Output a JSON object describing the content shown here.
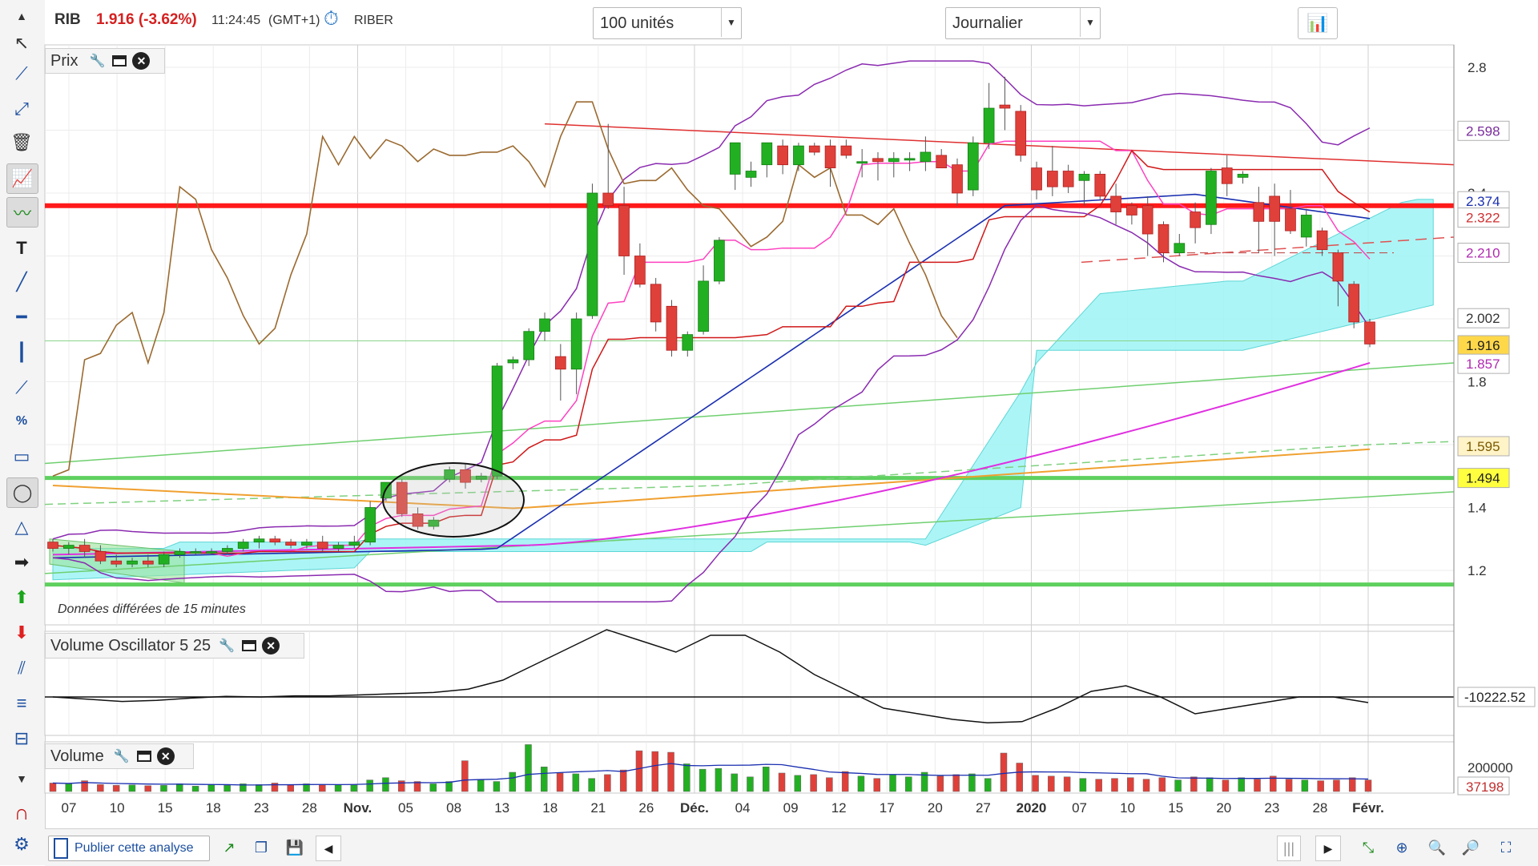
{
  "header": {
    "symbol": "RIB",
    "price_change": "1.916 (-3.62%)",
    "time": "11:24:45",
    "timezone": "(GMT+1)",
    "name": "RIBER",
    "units_select": "100 unités",
    "period_select": "Journalier"
  },
  "panels": {
    "price": "Prix",
    "volume_osc": "Volume Oscillator 5 25",
    "volume": "Volume"
  },
  "delayed_note": "Données différées de 15 minutes",
  "bottom": {
    "publish": "Publier cette analyse"
  },
  "colors": {
    "bull": "#22b022",
    "bear": "#e0403a",
    "ichimoku_cloud": "#9ef3f5",
    "support_line": "#5ed05e",
    "resistance_line": "#ff1a1a"
  },
  "chart_data": {
    "type": "candlestick",
    "x_tick_labels": [
      "07",
      "10",
      "15",
      "18",
      "23",
      "28",
      "Nov.",
      "05",
      "08",
      "13",
      "18",
      "21",
      "26",
      "Déc.",
      "04",
      "09",
      "12",
      "17",
      "20",
      "27",
      "2020",
      "07",
      "10",
      "15",
      "20",
      "23",
      "28",
      "Févr."
    ],
    "price_axis": {
      "ticks": [
        "2.8",
        "2.6",
        "2.4",
        "2.2",
        "2.0",
        "1.8",
        "1.6",
        "1.4",
        "1.2"
      ],
      "range": [
        1.1,
        2.85
      ]
    },
    "price_tags": [
      {
        "value": "2.598",
        "bg": "#ffffff",
        "fg": "#7a2c9c",
        "price": 2.598
      },
      {
        "value": "2.374",
        "bg": "#ffffff",
        "fg": "#1a2fb0",
        "price": 2.374
      },
      {
        "value": "2.322",
        "bg": "#ffffff",
        "fg": "#d03030",
        "price": 2.322
      },
      {
        "value": "2.210",
        "bg": "#ffffff",
        "fg": "#b02ab0",
        "price": 2.21
      },
      {
        "value": "2.002",
        "bg": "#ffffff",
        "fg": "#333333",
        "price": 2.002
      },
      {
        "value": "1.916",
        "bg": "#ffd84a",
        "fg": "#222222",
        "price": 1.916
      },
      {
        "value": "1.857",
        "bg": "#ffffff",
        "fg": "#b02ab0",
        "price": 1.857
      },
      {
        "value": "1.595",
        "bg": "#fff3c8",
        "fg": "#7a5a00",
        "price": 1.595
      },
      {
        "value": "1.494",
        "bg": "#ffff40",
        "fg": "#222222",
        "price": 1.494
      }
    ],
    "volume_osc_tag": "-10222.52",
    "volume_axis": {
      "tick": "200000",
      "last_tag": "37198"
    },
    "candles": [
      {
        "o": 1.29,
        "h": 1.3,
        "l": 1.26,
        "c": 1.27
      },
      {
        "o": 1.27,
        "h": 1.29,
        "l": 1.25,
        "c": 1.28
      },
      {
        "o": 1.28,
        "h": 1.3,
        "l": 1.24,
        "c": 1.26
      },
      {
        "o": 1.26,
        "h": 1.28,
        "l": 1.22,
        "c": 1.23
      },
      {
        "o": 1.23,
        "h": 1.25,
        "l": 1.21,
        "c": 1.22
      },
      {
        "o": 1.22,
        "h": 1.24,
        "l": 1.21,
        "c": 1.23
      },
      {
        "o": 1.23,
        "h": 1.25,
        "l": 1.21,
        "c": 1.22
      },
      {
        "o": 1.22,
        "h": 1.26,
        "l": 1.21,
        "c": 1.25
      },
      {
        "o": 1.25,
        "h": 1.27,
        "l": 1.24,
        "c": 1.26
      },
      {
        "o": 1.26,
        "h": 1.27,
        "l": 1.25,
        "c": 1.26
      },
      {
        "o": 1.26,
        "h": 1.27,
        "l": 1.25,
        "c": 1.26
      },
      {
        "o": 1.26,
        "h": 1.28,
        "l": 1.25,
        "c": 1.27
      },
      {
        "o": 1.27,
        "h": 1.3,
        "l": 1.26,
        "c": 1.29
      },
      {
        "o": 1.29,
        "h": 1.31,
        "l": 1.27,
        "c": 1.3
      },
      {
        "o": 1.3,
        "h": 1.31,
        "l": 1.28,
        "c": 1.29
      },
      {
        "o": 1.29,
        "h": 1.3,
        "l": 1.27,
        "c": 1.28
      },
      {
        "o": 1.28,
        "h": 1.3,
        "l": 1.27,
        "c": 1.29
      },
      {
        "o": 1.29,
        "h": 1.31,
        "l": 1.26,
        "c": 1.27
      },
      {
        "o": 1.27,
        "h": 1.29,
        "l": 1.26,
        "c": 1.28
      },
      {
        "o": 1.28,
        "h": 1.31,
        "l": 1.27,
        "c": 1.29
      },
      {
        "o": 1.29,
        "h": 1.42,
        "l": 1.28,
        "c": 1.4
      },
      {
        "o": 1.43,
        "h": 1.47,
        "l": 1.42,
        "c": 1.48
      },
      {
        "o": 1.48,
        "h": 1.49,
        "l": 1.37,
        "c": 1.38
      },
      {
        "o": 1.38,
        "h": 1.4,
        "l": 1.33,
        "c": 1.34
      },
      {
        "o": 1.34,
        "h": 1.37,
        "l": 1.33,
        "c": 1.36
      },
      {
        "o": 1.49,
        "h": 1.53,
        "l": 1.48,
        "c": 1.52
      },
      {
        "o": 1.52,
        "h": 1.54,
        "l": 1.46,
        "c": 1.48
      },
      {
        "o": 1.49,
        "h": 1.51,
        "l": 1.48,
        "c": 1.5
      },
      {
        "o": 1.5,
        "h": 1.86,
        "l": 1.49,
        "c": 1.85
      },
      {
        "o": 1.86,
        "h": 1.88,
        "l": 1.84,
        "c": 1.87
      },
      {
        "o": 1.87,
        "h": 1.97,
        "l": 1.85,
        "c": 1.96
      },
      {
        "o": 1.96,
        "h": 2.02,
        "l": 1.93,
        "c": 2.0
      },
      {
        "o": 1.88,
        "h": 1.92,
        "l": 1.74,
        "c": 1.84
      },
      {
        "o": 1.84,
        "h": 2.02,
        "l": 1.76,
        "c": 2.0
      },
      {
        "o": 2.01,
        "h": 2.43,
        "l": 2.0,
        "c": 2.4
      },
      {
        "o": 2.4,
        "h": 2.62,
        "l": 2.35,
        "c": 2.36
      },
      {
        "o": 2.36,
        "h": 2.42,
        "l": 2.14,
        "c": 2.2
      },
      {
        "o": 2.2,
        "h": 2.24,
        "l": 2.1,
        "c": 2.11
      },
      {
        "o": 2.11,
        "h": 2.13,
        "l": 1.96,
        "c": 1.99
      },
      {
        "o": 2.04,
        "h": 2.06,
        "l": 1.88,
        "c": 1.9
      },
      {
        "o": 1.9,
        "h": 1.96,
        "l": 1.88,
        "c": 1.95
      },
      {
        "o": 1.96,
        "h": 2.17,
        "l": 1.95,
        "c": 2.12
      },
      {
        "o": 2.12,
        "h": 2.26,
        "l": 2.11,
        "c": 2.25
      },
      {
        "o": 2.46,
        "h": 2.56,
        "l": 2.41,
        "c": 2.56
      },
      {
        "o": 2.45,
        "h": 2.5,
        "l": 2.42,
        "c": 2.47
      },
      {
        "o": 2.49,
        "h": 2.56,
        "l": 2.45,
        "c": 2.56
      },
      {
        "o": 2.55,
        "h": 2.57,
        "l": 2.46,
        "c": 2.49
      },
      {
        "o": 2.49,
        "h": 2.56,
        "l": 2.47,
        "c": 2.55
      },
      {
        "o": 2.55,
        "h": 2.56,
        "l": 2.52,
        "c": 2.53
      },
      {
        "o": 2.55,
        "h": 2.57,
        "l": 2.42,
        "c": 2.48
      },
      {
        "o": 2.55,
        "h": 2.57,
        "l": 2.51,
        "c": 2.52
      },
      {
        "o": 2.5,
        "h": 2.54,
        "l": 2.45,
        "c": 2.5
      },
      {
        "o": 2.51,
        "h": 2.53,
        "l": 2.44,
        "c": 2.5
      },
      {
        "o": 2.5,
        "h": 2.53,
        "l": 2.45,
        "c": 2.51
      },
      {
        "o": 2.51,
        "h": 2.53,
        "l": 2.47,
        "c": 2.51
      },
      {
        "o": 2.5,
        "h": 2.58,
        "l": 2.47,
        "c": 2.53
      },
      {
        "o": 2.52,
        "h": 2.54,
        "l": 2.48,
        "c": 2.48
      },
      {
        "o": 2.49,
        "h": 2.51,
        "l": 2.36,
        "c": 2.4
      },
      {
        "o": 2.41,
        "h": 2.58,
        "l": 2.39,
        "c": 2.56
      },
      {
        "o": 2.56,
        "h": 2.75,
        "l": 2.54,
        "c": 2.67
      },
      {
        "o": 2.68,
        "h": 2.77,
        "l": 2.6,
        "c": 2.67
      },
      {
        "o": 2.66,
        "h": 2.68,
        "l": 2.5,
        "c": 2.52
      },
      {
        "o": 2.48,
        "h": 2.5,
        "l": 2.38,
        "c": 2.41
      },
      {
        "o": 2.47,
        "h": 2.55,
        "l": 2.39,
        "c": 2.42
      },
      {
        "o": 2.47,
        "h": 2.49,
        "l": 2.4,
        "c": 2.42
      },
      {
        "o": 2.44,
        "h": 2.47,
        "l": 2.36,
        "c": 2.46
      },
      {
        "o": 2.46,
        "h": 2.47,
        "l": 2.38,
        "c": 2.39
      },
      {
        "o": 2.39,
        "h": 2.43,
        "l": 2.3,
        "c": 2.34
      },
      {
        "o": 2.36,
        "h": 2.37,
        "l": 2.3,
        "c": 2.33
      },
      {
        "o": 2.36,
        "h": 2.39,
        "l": 2.2,
        "c": 2.27
      },
      {
        "o": 2.3,
        "h": 2.31,
        "l": 2.18,
        "c": 2.21
      },
      {
        "o": 2.21,
        "h": 2.27,
        "l": 2.2,
        "c": 2.24
      },
      {
        "o": 2.34,
        "h": 2.37,
        "l": 2.24,
        "c": 2.29
      },
      {
        "o": 2.3,
        "h": 2.48,
        "l": 2.27,
        "c": 2.47
      },
      {
        "o": 2.48,
        "h": 2.52,
        "l": 2.39,
        "c": 2.43
      },
      {
        "o": 2.45,
        "h": 2.47,
        "l": 2.43,
        "c": 2.46
      },
      {
        "o": 2.37,
        "h": 2.42,
        "l": 2.21,
        "c": 2.31
      },
      {
        "o": 2.39,
        "h": 2.43,
        "l": 2.2,
        "c": 2.31
      },
      {
        "o": 2.35,
        "h": 2.41,
        "l": 2.27,
        "c": 2.28
      },
      {
        "o": 2.26,
        "h": 2.35,
        "l": 2.23,
        "c": 2.33
      },
      {
        "o": 2.28,
        "h": 2.29,
        "l": 2.2,
        "c": 2.22
      },
      {
        "o": 2.21,
        "h": 2.22,
        "l": 2.04,
        "c": 2.12
      },
      {
        "o": 2.11,
        "h": 2.12,
        "l": 1.97,
        "c": 1.99
      },
      {
        "o": 1.99,
        "h": 2.0,
        "l": 1.91,
        "c": 1.92
      }
    ],
    "volumes": [
      22,
      20,
      28,
      18,
      16,
      17,
      15,
      16,
      20,
      14,
      18,
      16,
      20,
      18,
      22,
      17,
      20,
      17,
      18,
      17,
      30,
      36,
      28,
      26,
      20,
      26,
      80,
      30,
      26,
      50,
      122,
      64,
      48,
      46,
      34,
      44,
      56,
      106,
      104,
      102,
      72,
      58,
      60,
      46,
      38,
      64,
      48,
      42,
      44,
      36,
      52,
      40,
      34,
      44,
      38,
      50,
      40,
      44,
      46,
      34,
      100,
      74,
      42,
      40,
      38,
      34,
      32,
      34,
      36,
      32,
      36,
      30,
      38,
      36,
      30,
      36,
      32,
      40,
      32,
      30,
      28,
      30,
      36,
      30
    ],
    "vol_osc": [
      0,
      -4,
      -8,
      -6,
      -2,
      1,
      0,
      2,
      2,
      4,
      6,
      8,
      14,
      30,
      60,
      90,
      120,
      100,
      80,
      110,
      110,
      80,
      40,
      10,
      -20,
      -30,
      -40,
      -46,
      -44,
      -20,
      10,
      20,
      0,
      -30,
      -20,
      -10,
      0,
      0,
      -10
    ]
  }
}
